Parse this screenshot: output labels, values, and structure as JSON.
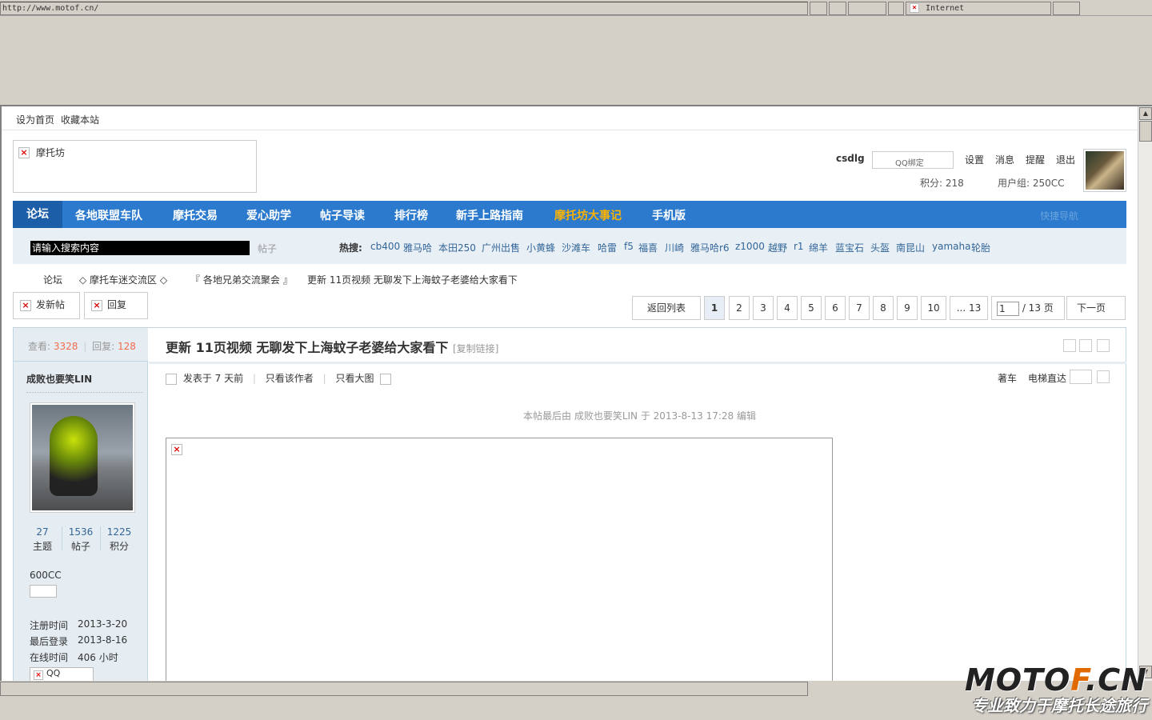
{
  "browser": {
    "url": "http://www.motof.cn/",
    "zone": "Internet"
  },
  "toplinks": [
    "设为首页",
    "收藏本站"
  ],
  "site": {
    "logo_alt": "摩托坊"
  },
  "user": {
    "name": "csdlg",
    "qq_bind": "QQ绑定",
    "links": [
      "设置",
      "消息",
      "提醒",
      "退出"
    ],
    "points_label": "积分: 218",
    "group_label": "用户组: 250CC"
  },
  "nav": {
    "items": [
      "论坛",
      "各地联盟车队",
      "摩托交易",
      "爱心助学",
      "帖子导读",
      "排行榜",
      "新手上路指南",
      "摩托坊大事记",
      "手机版"
    ],
    "right": "快捷导航"
  },
  "search": {
    "placeholder": "请输入搜索内容",
    "type": "帖子",
    "hot_label": "热搜:",
    "hot": [
      "cb400",
      "雅马哈",
      "本田250",
      "广州出售",
      "小黄蜂",
      "沙滩车",
      "哈雷",
      "f5",
      "福喜",
      "川崎",
      "雅马哈r6",
      "z1000",
      "越野",
      "r1",
      "绵羊",
      "蓝宝石",
      "头盔",
      "南昆山",
      "yamaha",
      "轮胎"
    ]
  },
  "breadcrumb": [
    "论坛",
    "◇ 摩托车迷交流区 ◇",
    "『 各地兄弟交流聚会 』",
    "更新 11页视频 无聊发下上海蚊子老婆给大家看下"
  ],
  "actions": {
    "new_post": "发新帖",
    "reply": "回复"
  },
  "pagination": {
    "back": "返回列表",
    "pages": [
      "1",
      "2",
      "3",
      "4",
      "5",
      "6",
      "7",
      "8",
      "9",
      "10",
      "... 13"
    ],
    "current": "1",
    "input_value": "1",
    "total": "/ 13 页",
    "next": "下一页"
  },
  "thread": {
    "views_label": "查看:",
    "views": "3328",
    "replies_label": "回复:",
    "replies": "128",
    "title": "更新 11页视频 无聊发下上海蚊子老婆给大家看下",
    "copy_link": "[复制链接]",
    "posted": "发表于 7 天前",
    "only_author": "只看该作者",
    "only_big": "只看大图",
    "floor_label": "著车",
    "jump_label": "电梯直达",
    "edited_note": "本帖最后由 成败也要笑LIN 于 2013-8-13 17:28 编辑"
  },
  "author": {
    "name": "成败也要笑LIN",
    "stats": [
      {
        "value": "27",
        "label": "主题"
      },
      {
        "value": "1536",
        "label": "帖子"
      },
      {
        "value": "1225",
        "label": "积分"
      }
    ],
    "group": "600CC",
    "info": [
      {
        "label": "注册时间",
        "value": "2013-3-20"
      },
      {
        "label": "最后登录",
        "value": "2013-8-16"
      },
      {
        "label": "在线时间",
        "value": "406 小时"
      }
    ],
    "qq": "QQ"
  },
  "watermark": {
    "brand_a": "MOTO",
    "brand_b": "F",
    "brand_c": ".CN",
    "slogan": "专业致力于摩托长途旅行"
  }
}
